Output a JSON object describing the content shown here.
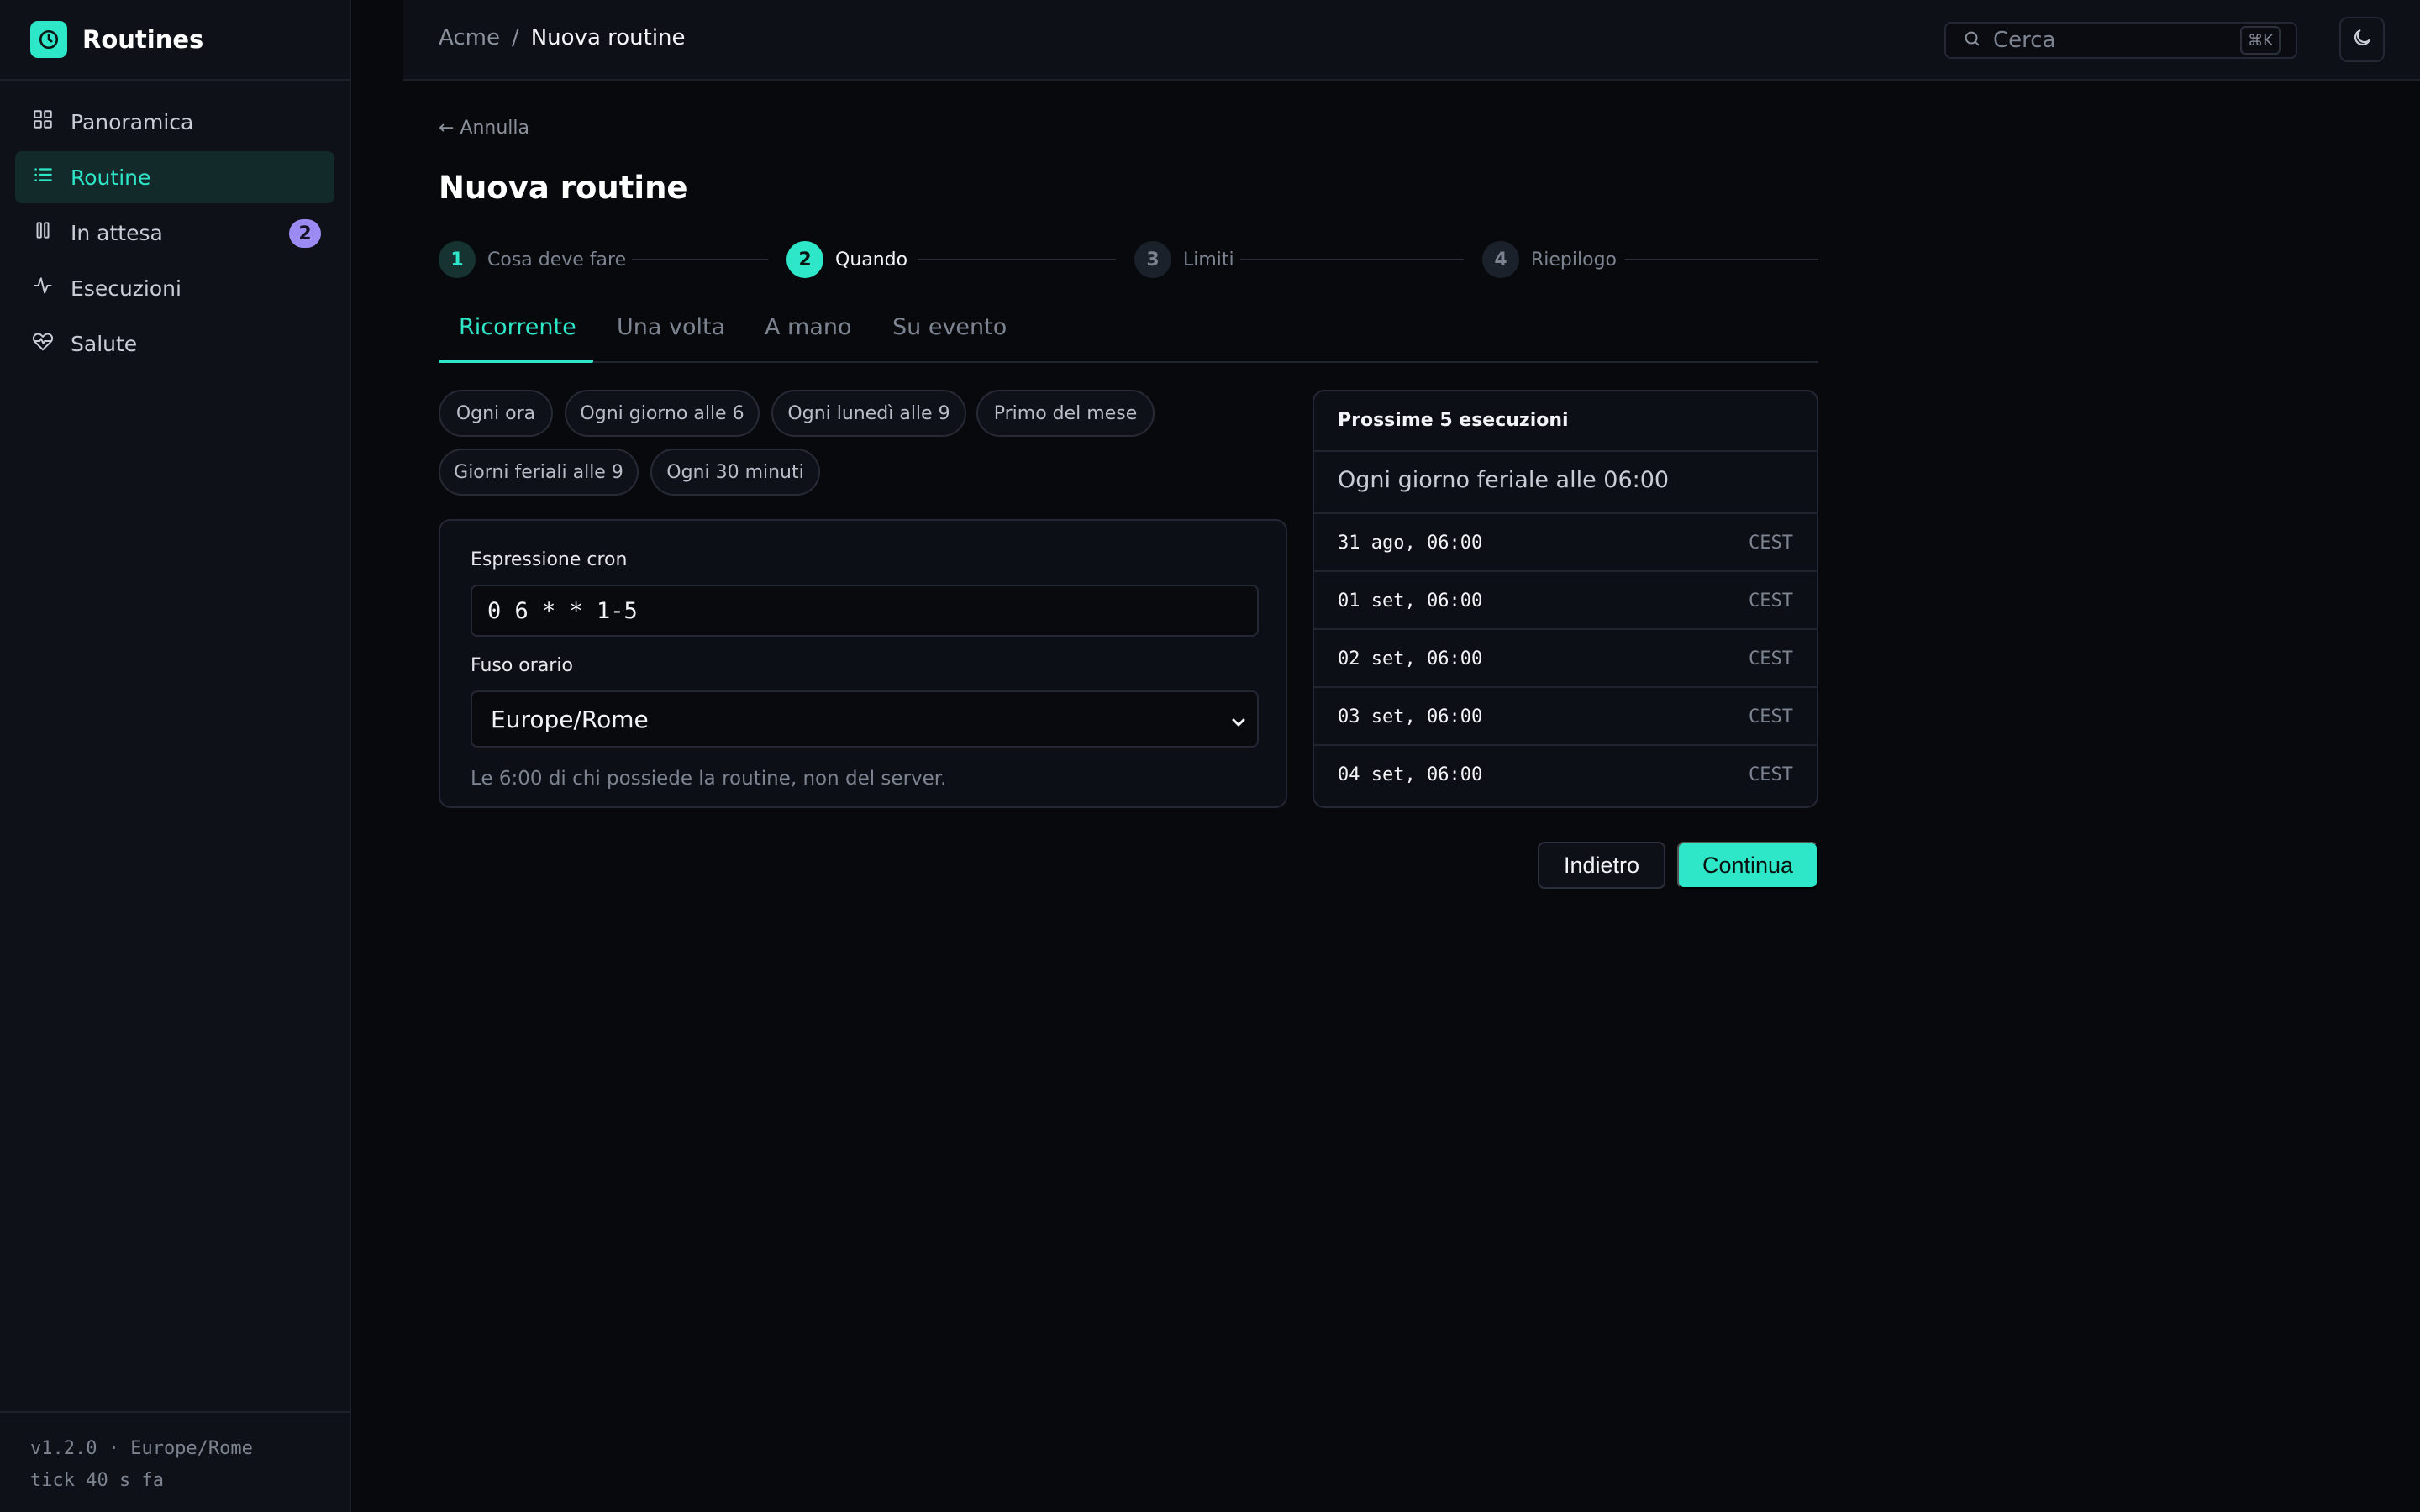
{
  "app": {
    "title": "Routines",
    "accent": "#2ee6c8"
  },
  "sidebar": {
    "items": [
      {
        "label": "Panoramica",
        "icon": "grid-icon"
      },
      {
        "label": "Routine",
        "icon": "list-icon",
        "active": true
      },
      {
        "label": "In attesa",
        "icon": "pause-icon",
        "badge": "2"
      },
      {
        "label": "Esecuzioni",
        "icon": "activity-icon"
      },
      {
        "label": "Salute",
        "icon": "heart-pulse-icon"
      }
    ],
    "footer": {
      "line1": "v1.2.0 · Europe/Rome",
      "line2": "tick 40 s fa"
    }
  },
  "header": {
    "breadcrumb": {
      "root": "Acme",
      "separator": "/",
      "current": "Nuova routine"
    },
    "search": {
      "placeholder": "Cerca",
      "shortcut": "⌘K"
    }
  },
  "main": {
    "back_link": "← Annulla",
    "title": "Nuova routine",
    "steps": [
      {
        "num": "1",
        "label": "Cosa deve fare",
        "state": "done"
      },
      {
        "num": "2",
        "label": "Quando",
        "state": "active"
      },
      {
        "num": "3",
        "label": "Limiti",
        "state": "pending"
      },
      {
        "num": "4",
        "label": "Riepilogo",
        "state": "pending"
      }
    ],
    "tabs": [
      "Ricorrente",
      "Una volta",
      "A mano",
      "Su evento"
    ],
    "active_tab": "Ricorrente",
    "presets": [
      "Ogni ora",
      "Ogni giorno alle 6",
      "Ogni lunedì alle 9",
      "Primo del mese",
      "Giorni feriali alle 9",
      "Ogni 30 minuti"
    ],
    "cron": {
      "label": "Espressione cron",
      "value": "0 6 * * 1-5",
      "tz_label": "Fuso orario",
      "tz_value": "Europe/Rome",
      "hint": "Le 6:00 di chi possiede la routine, non del server."
    },
    "next_runs": {
      "title": "Prossime 5 esecuzioni",
      "description": "Ogni giorno feriale alle 06:00",
      "rows": [
        {
          "date": "31 ago, 06:00",
          "tz": "CEST"
        },
        {
          "date": "01 set, 06:00",
          "tz": "CEST"
        },
        {
          "date": "02 set, 06:00",
          "tz": "CEST"
        },
        {
          "date": "03 set, 06:00",
          "tz": "CEST"
        },
        {
          "date": "04 set, 06:00",
          "tz": "CEST"
        }
      ]
    },
    "buttons": {
      "back": "Indietro",
      "next": "Continua"
    }
  }
}
